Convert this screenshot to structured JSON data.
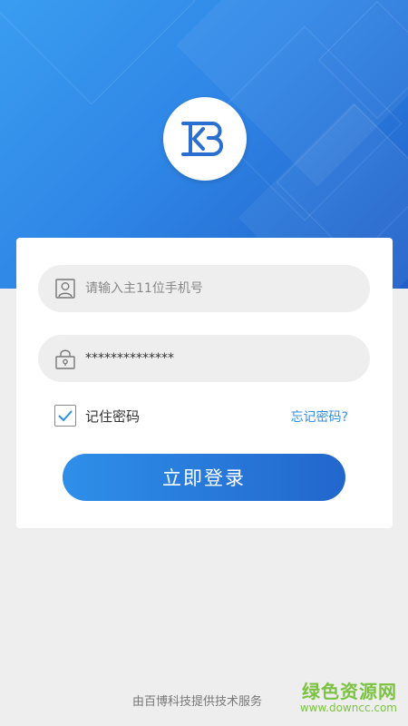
{
  "login": {
    "phone_placeholder": "请输入主11位手机号",
    "password_value": "**************",
    "remember_label": "记住密码",
    "remember_checked": true,
    "forgot_label": "忘记密码?",
    "submit_label": "立即登录"
  },
  "footer": {
    "provider_text": "由百博科技提供技术服务"
  },
  "watermark": {
    "title": "绿色资源网",
    "url": "www.downcc.com"
  },
  "colors": {
    "brand_blue": "#2e8fe9",
    "brand_dark_blue": "#1f5fc7",
    "link_blue": "#2e8fe6",
    "watermark_green": "#7cc242"
  },
  "icons": {
    "logo": "kb-logo-icon",
    "phone_field": "user-icon",
    "password_field": "lock-icon",
    "remember": "checkmark-icon"
  }
}
